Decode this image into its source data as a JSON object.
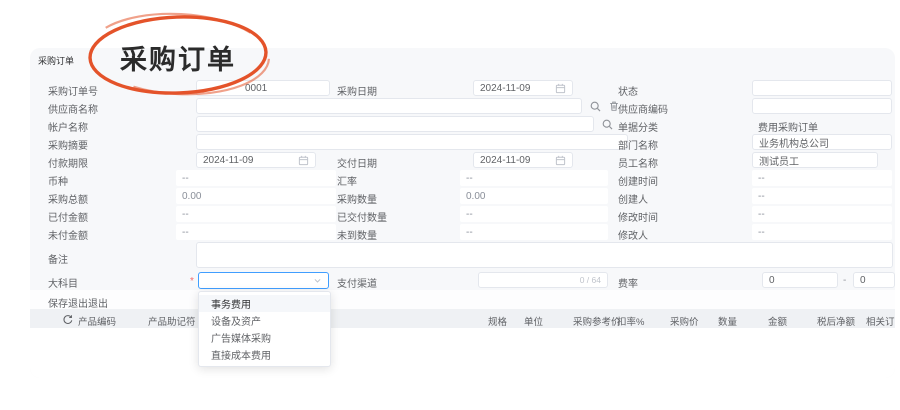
{
  "app": {
    "tab_title": "采购订单",
    "annotation_title": "采购订单"
  },
  "fields": {
    "order_no": {
      "label": "采购订单号",
      "value": "0001"
    },
    "purchase_date": {
      "label": "采购日期",
      "value": "2024-11-09"
    },
    "status": {
      "label": "状态",
      "value": ""
    },
    "supplier_name": {
      "label": "供应商名称",
      "value": ""
    },
    "supplier_code": {
      "label": "供应商编码",
      "value": ""
    },
    "account_name": {
      "label": "帐户名称",
      "value": ""
    },
    "doc_category": {
      "label": "单据分类",
      "value": "费用采购订单"
    },
    "purchase_summary": {
      "label": "采购摘要",
      "value": ""
    },
    "department_name": {
      "label": "部门名称",
      "value": "业务机构总公司"
    },
    "payment_term": {
      "label": "付款期限",
      "value": "2024-11-09"
    },
    "delivery_date": {
      "label": "交付日期",
      "value": "2024-11-09"
    },
    "employee_name": {
      "label": "员工名称",
      "value": "测试员工"
    },
    "currency": {
      "label": "币种",
      "value": "--"
    },
    "exchange_rate": {
      "label": "汇率",
      "value": "--"
    },
    "created_time": {
      "label": "创建时间",
      "value": "--"
    },
    "purchase_total": {
      "label": "采购总额",
      "value": "0.00"
    },
    "purchase_qty": {
      "label": "采购数量",
      "value": "0.00"
    },
    "creator": {
      "label": "创建人",
      "value": "--"
    },
    "paid_amount": {
      "label": "已付金额",
      "value": "--"
    },
    "delivered_qty": {
      "label": "已交付数量",
      "value": "--"
    },
    "modified_time": {
      "label": "修改时间",
      "value": "--"
    },
    "unpaid_amount": {
      "label": "未付金额",
      "value": "--"
    },
    "pending_qty": {
      "label": "未到数量",
      "value": "--"
    },
    "modifier": {
      "label": "修改人",
      "value": "--"
    },
    "remark": {
      "label": "备注",
      "value": ""
    },
    "major_subject": {
      "label": "大科目",
      "required_mark": "*",
      "value": ""
    },
    "payment_channel": {
      "label": "支付渠道",
      "value": "",
      "counter": "0 / 64"
    },
    "fee_rate": {
      "label": "费率",
      "min": "0",
      "separator": "-",
      "max": "0"
    }
  },
  "actions": {
    "save_exit": "保存退出",
    "exit": "退出"
  },
  "subject_dropdown": {
    "options": [
      "事务费用",
      "设备及资产",
      "广告媒体采购",
      "直接成本费用"
    ],
    "highlighted": "事务费用"
  },
  "items_table": {
    "headers": [
      "产品编码",
      "产品助记符",
      "规格",
      "单位",
      "采购参考价",
      "扣率%",
      "采购价",
      "数量",
      "金额",
      "税后净额",
      "相关订单"
    ]
  },
  "colors": {
    "accent_blue": "#409eff",
    "annotation_orange": "#e4532a",
    "card_bg": "#f7f8fa"
  }
}
